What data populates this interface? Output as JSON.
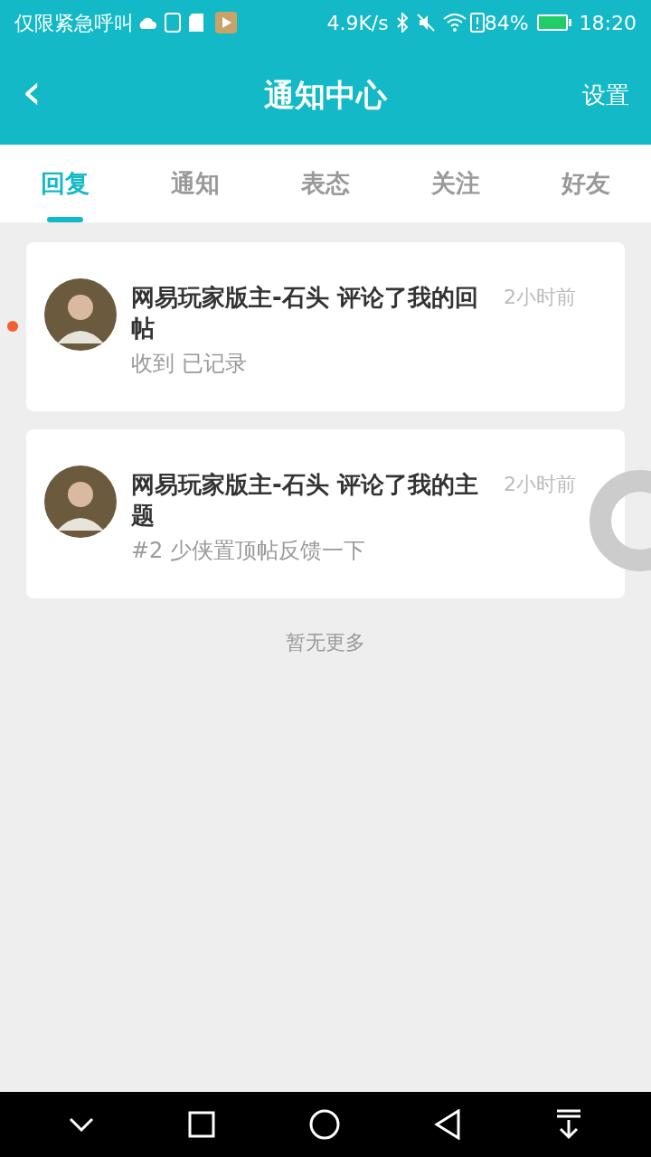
{
  "status_bar": {
    "carrier": "仅限紧急呼叫",
    "speed": "4.9K/s",
    "battery": "84%",
    "time": "18:20"
  },
  "header": {
    "back": "‹",
    "title": "通知中心",
    "action": "设置"
  },
  "tabs": [
    {
      "label": "回复",
      "selected": true
    },
    {
      "label": "通知",
      "selected": false
    },
    {
      "label": "表态",
      "selected": false
    },
    {
      "label": "关注",
      "selected": false
    },
    {
      "label": "好友",
      "selected": false
    }
  ],
  "notifications": [
    {
      "title": "网易玩家版主-石头 评论了我的回帖",
      "time": "2小时前",
      "text": "收到 已记录",
      "unread": true
    },
    {
      "title": "网易玩家版主-石头 评论了我的主题",
      "time": "2小时前",
      "text": "#2 少侠置顶帖反馈一下",
      "unread": false
    }
  ],
  "footer": "暂无更多"
}
